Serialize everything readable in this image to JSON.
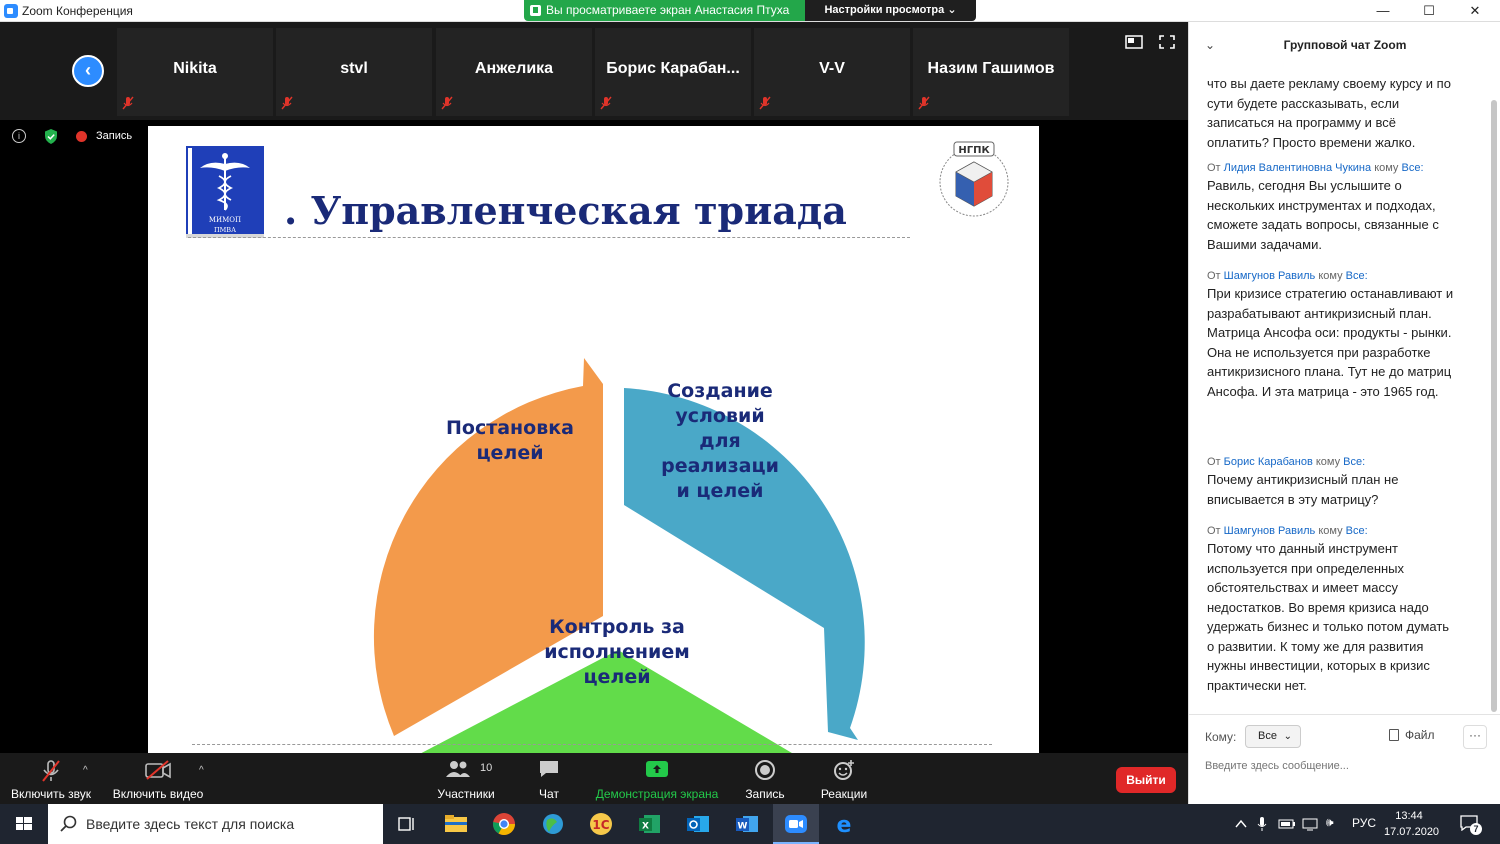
{
  "window": {
    "title": "Zoom Конференция",
    "minimize": "—",
    "maximize": "☐",
    "close": "✕"
  },
  "banner": {
    "viewing_text": "Вы просматриваете экран Анастасия Птуха",
    "view_options": "Настройки просмотра ⌄"
  },
  "participants_strip": [
    {
      "name": "Nikita"
    },
    {
      "name": "stvl"
    },
    {
      "name": "Анжелика"
    },
    {
      "name": "Борис Карабан..."
    },
    {
      "name": "V-V"
    },
    {
      "name": "Назим Гашимов"
    }
  ],
  "status": {
    "recording_label": "Запись",
    "info_glyph": "i"
  },
  "slide": {
    "title": ". Управленческая триада",
    "book_text_1": "МИМОП",
    "book_text_2": "ПМВА",
    "logo_text": "НГПК",
    "segments": {
      "orange_lines": [
        "Постановка",
        "целей"
      ],
      "blue_lines": [
        "Создание",
        "условий",
        "для",
        "реализаци",
        "и целей"
      ],
      "green_lines": [
        "Контроль за",
        "исполнением",
        "целей"
      ]
    },
    "colors": {
      "orange": "#f39a4b",
      "blue": "#4aa8c8",
      "green": "#62dc4a",
      "title": "#1a2a78"
    }
  },
  "toolbar": {
    "audio_label": "Включить звук",
    "video_label": "Включить видео",
    "participants_label": "Участники",
    "participants_count": "10",
    "chat_label": "Чат",
    "share_label": "Демонстрация экрана",
    "record_label": "Запись",
    "reactions_label": "Реакции",
    "leave_label": "Выйти",
    "share_color": "#23c94a"
  },
  "chat": {
    "title": "Групповой чат Zoom",
    "messages": [
      {
        "from": "",
        "to": "",
        "text": "что вы даете рекламу своему курсу и по сути будете рассказывать, если записаться на программу и всё оплатить? Просто времени жалко."
      },
      {
        "from": "Лидия Валентиновна Чукина",
        "to": "Все:",
        "text": "Равиль, сегодня Вы услышите о нескольких инструментах и подходах, сможете задать вопросы, связанные с Вашими задачами."
      },
      {
        "from": "Шамгунов Равиль",
        "to": "Все:",
        "text": "При кризисе стратегию останавливают и разрабатывают антикризисный план. Матрица Ансофа оси: продукты - рынки. Она не используется при разработке антикризисного плана. Тут не до матриц Ансофа. И эта матрица - это 1965 год."
      },
      {
        "from": "Борис Карабанов",
        "to": "Все:",
        "text": "Почему антикризисный план не вписывается в эту матрицу?"
      },
      {
        "from": "Шамгунов Равиль",
        "to": "Все:",
        "text": "Потому что данный инструмент используется при определенных обстоятельствах и имеет массу недостатков. Во время кризиса надо удержать бизнес и только потом думать о развитии. К тому же для развития нужны инвестиции, которых в кризис практически нет."
      }
    ],
    "from_prefix": "От",
    "to_word": "кому",
    "to_label": "Кому:",
    "to_value": "Все",
    "file_label": "Файл",
    "more_label": "···",
    "input_placeholder": "Введите здесь сообщение..."
  },
  "taskbar": {
    "search_placeholder": "Введите здесь текст для поиска",
    "time": "13:44",
    "date": "17.07.2020",
    "language": "РУС",
    "notification_count": "7"
  }
}
